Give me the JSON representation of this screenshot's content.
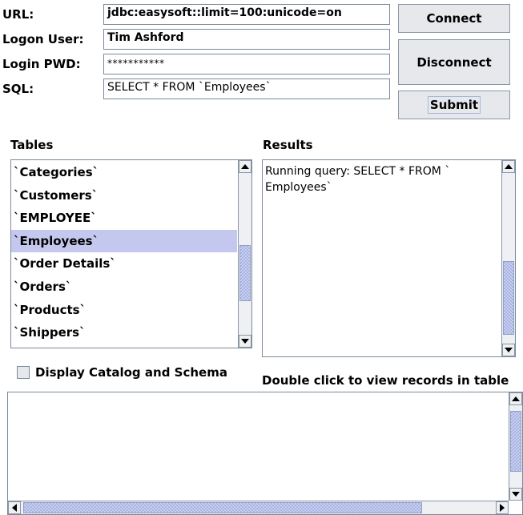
{
  "form": {
    "url_label": "URL:",
    "url_value": "jdbc:easysoft::limit=100:unicode=on",
    "user_label": "Logon User:",
    "user_value": "Tim Ashford",
    "pwd_label": "Login PWD:",
    "pwd_value": "***********",
    "sql_label": "SQL:",
    "sql_value": "SELECT * FROM `Employees`"
  },
  "buttons": {
    "connect": "Connect",
    "disconnect": "Disconnect",
    "submit": "Submit"
  },
  "tables": {
    "heading": "Tables",
    "items": [
      "`Categories`",
      "`Customers`",
      "`EMPLOYEE`",
      "`Employees`",
      "`Order Details`",
      "`Orders`",
      "`Products`",
      "`Shippers`"
    ],
    "selected_index": 3
  },
  "results": {
    "heading": "Results",
    "lines": [
      "Running query: SELECT * FROM `",
      "Employees`"
    ]
  },
  "options": {
    "display_catalog_label": "Display Catalog and Schema",
    "display_catalog_checked": false,
    "hint": "Double click to view records in table"
  },
  "icons": {
    "scroll_up": "arrow-up-icon",
    "scroll_down": "arrow-down-icon",
    "scroll_left": "arrow-left-icon",
    "scroll_right": "arrow-right-icon"
  },
  "colors": {
    "selection": "#c5c8ee",
    "scrollbar_thumb": "#a9b4e0",
    "button_face": "#e6e8ec"
  }
}
